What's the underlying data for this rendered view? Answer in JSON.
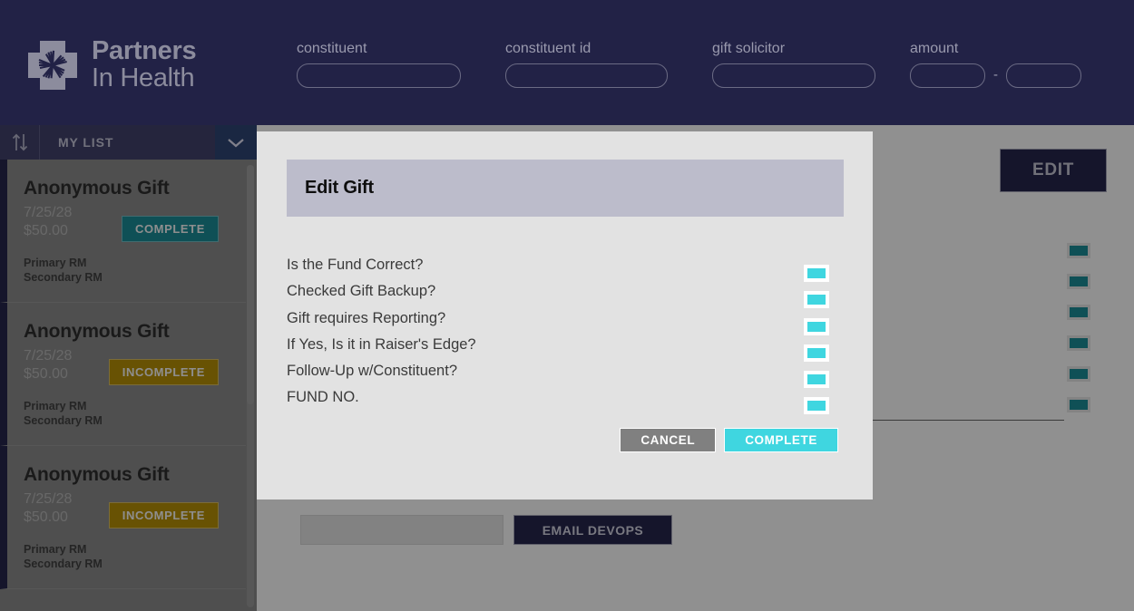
{
  "header": {
    "brand": {
      "line1": "Partners",
      "line2": "In Health",
      "logo_icon": "pih-hands-logo-icon"
    },
    "filters": [
      {
        "label": "constituent",
        "value": "",
        "placeholder": ""
      },
      {
        "label": "constituent id",
        "value": "",
        "placeholder": ""
      },
      {
        "label": "gift solicitor",
        "value": "",
        "placeholder": ""
      }
    ],
    "amount": {
      "label": "amount",
      "min_value": "",
      "max_value": "",
      "separator": "-"
    }
  },
  "sidebar": {
    "toolbar": {
      "sort_icon": "sort-up-down-icon",
      "list_label": "MY LIST",
      "dropdown_icon": "chevron-down-icon"
    },
    "cards": [
      {
        "title": "Anonymous Gift",
        "date": "7/25/28",
        "amount": "$50.00",
        "status": "COMPLETE",
        "status_kind": "complete",
        "primary_rm": "Primary RM",
        "secondary_rm": "Secondary RM"
      },
      {
        "title": "Anonymous Gift",
        "date": "7/25/28",
        "amount": "$50.00",
        "status": "INCOMPLETE",
        "status_kind": "incomplete",
        "primary_rm": "Primary RM",
        "secondary_rm": "Secondary RM"
      },
      {
        "title": "Anonymous Gift",
        "date": "7/25/28",
        "amount": "$50.00",
        "status": "INCOMPLETE",
        "status_kind": "incomplete",
        "primary_rm": "Primary RM",
        "secondary_rm": "Secondary RM"
      }
    ]
  },
  "main": {
    "edit_label": "EDIT",
    "checkbox_count": 6,
    "email": {
      "input_value": "",
      "button_label": "EMAIL DEVOPS"
    }
  },
  "modal": {
    "title": "Edit Gift",
    "rows": [
      {
        "label": "Is the Fund Correct?",
        "checked": true
      },
      {
        "label": "Checked Gift Backup?",
        "checked": true
      },
      {
        "label": "Gift requires Reporting?",
        "checked": true
      },
      {
        "label": "If Yes, Is it in Raiser's Edge?",
        "checked": true
      },
      {
        "label": "Follow-Up w/Constituent?",
        "checked": true
      },
      {
        "label": "FUND NO.",
        "checked": true
      }
    ],
    "cancel_label": "CANCEL",
    "complete_label": "COMPLETE"
  },
  "colors": {
    "brand_navy": "#222246",
    "teal": "#19818b",
    "cyan": "#3fd6e0",
    "gold": "#a98505",
    "modal_bg": "#e2e2e2",
    "modal_header": "#bcbccb"
  }
}
